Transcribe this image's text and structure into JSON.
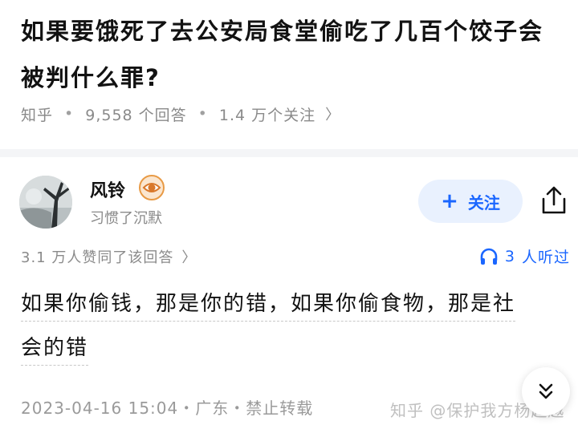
{
  "question": {
    "title": "如果要饿死了去公安局食堂偷吃了几百个饺子会被判什么罪?",
    "source": "知乎",
    "answers_count": "9,558 个回答",
    "followers": "1.4 万个关注",
    "chevron": "〉"
  },
  "author": {
    "name": "风铃",
    "signature": "习惯了沉默",
    "follow_label": "关注",
    "follow_plus": "+"
  },
  "stats": {
    "votes_text": "3.1 万人赞同了该回答",
    "chevron": "〉",
    "listen_count": "3",
    "listen_label": "人听过"
  },
  "answer": {
    "line1": "如果你偷钱，那是你的错，如果你偷食物，那是社",
    "line2": "会的错",
    "footer": "2023-04-16 15:04・广东・禁止转载"
  },
  "watermark": "知乎 @保护我方杨超越",
  "colors": {
    "accent": "#1a66ff",
    "follow_bg": "#e9f1fe",
    "text": "#121212",
    "muted": "#8a8a8a"
  }
}
